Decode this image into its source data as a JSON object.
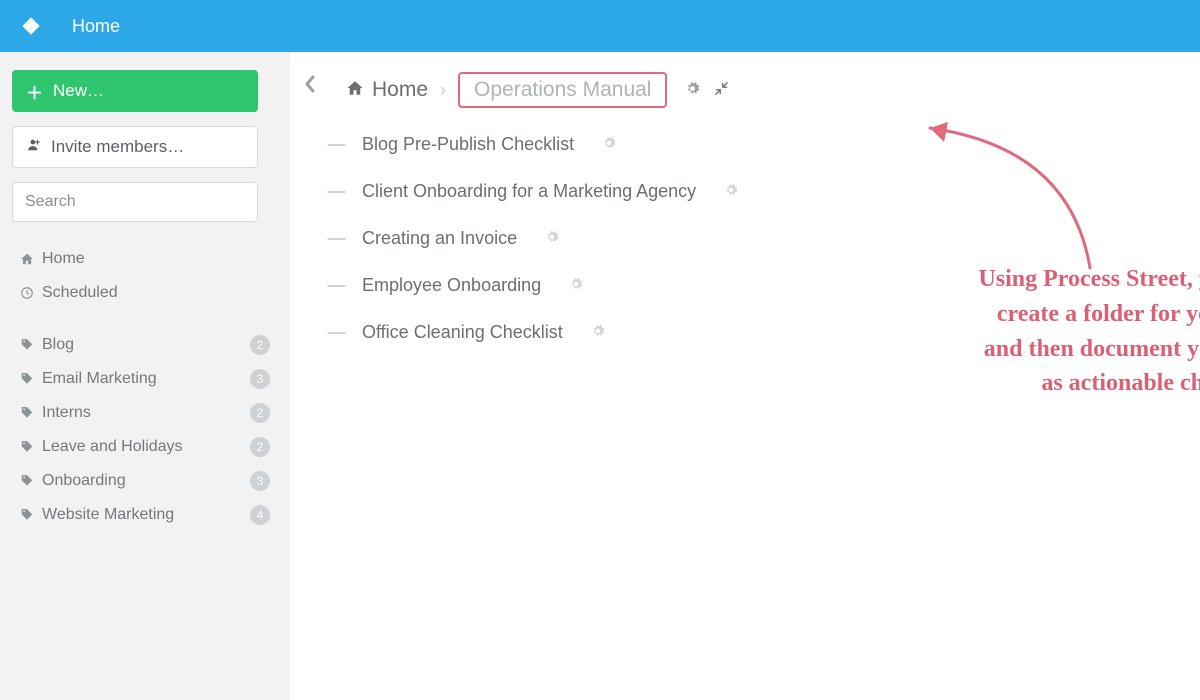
{
  "topbar": {
    "title": "Home"
  },
  "sidebar": {
    "new_label": "New…",
    "invite_label": "Invite members…",
    "search_placeholder": "Search",
    "nav_primary": [
      {
        "icon": "home-icon",
        "label": "Home"
      },
      {
        "icon": "clock-icon",
        "label": "Scheduled"
      }
    ],
    "tags": [
      {
        "label": "Blog",
        "count": "2"
      },
      {
        "label": "Email Marketing",
        "count": "3"
      },
      {
        "label": "Interns",
        "count": "2"
      },
      {
        "label": "Leave and Holidays",
        "count": "2"
      },
      {
        "label": "Onboarding",
        "count": "3"
      },
      {
        "label": "Website Marketing",
        "count": "4"
      }
    ]
  },
  "breadcrumb": {
    "home_label": "Home",
    "current": "Operations Manual"
  },
  "templates": [
    {
      "name": "Blog Pre-Publish Checklist"
    },
    {
      "name": "Client Onboarding for a Marketing Agency"
    },
    {
      "name": "Creating an Invoice"
    },
    {
      "name": "Employee Onboarding"
    },
    {
      "name": "Office Cleaning Checklist"
    }
  ],
  "annotation": {
    "line1": "Using Process Street, you can easily",
    "line2": "create a folder for your manual,",
    "line3": "and then document your processes",
    "line4": "as actionable checklists"
  },
  "colors": {
    "topbar": "#2ca8e8",
    "new_button": "#2fc66f",
    "annotation": "#da6074"
  }
}
